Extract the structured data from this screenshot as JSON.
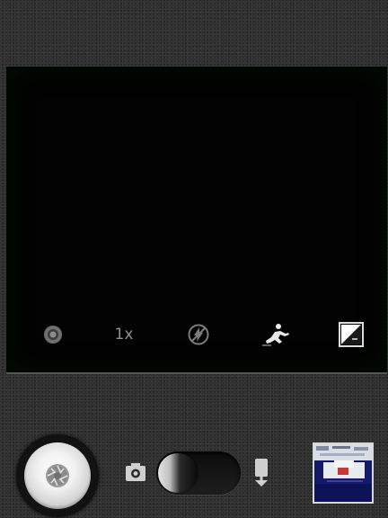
{
  "viewfinder": {
    "settings": [
      {
        "name": "camera-settings",
        "icon": "settings-dot-icon"
      },
      {
        "name": "zoom",
        "label": "1x"
      },
      {
        "name": "flash",
        "icon": "flash-off-icon"
      },
      {
        "name": "scene-mode",
        "icon": "scene-action-icon"
      },
      {
        "name": "exposure",
        "icon": "exposure-icon"
      }
    ]
  },
  "controls": {
    "shutter_icon": "aperture-icon",
    "mode_still_icon": "camera-icon",
    "mode_video_icon": "video-camera-icon",
    "mode_selected": "camera",
    "gallery_thumbnail_icon": "last-photo-thumbnail"
  },
  "colors": {
    "viewfinder_bg": "#020302",
    "icon_gray": "#8a8a8a",
    "thumbnail_bg": "#1a1f6a"
  }
}
